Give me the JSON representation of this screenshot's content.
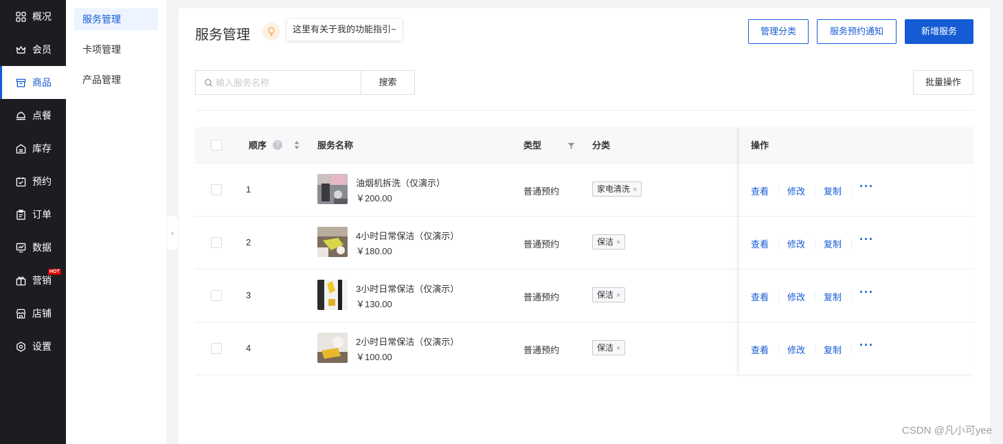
{
  "nav": {
    "items": [
      {
        "label": "概况",
        "icon": "grid-icon"
      },
      {
        "label": "会员",
        "icon": "crown-icon"
      },
      {
        "label": "商品",
        "icon": "store-icon",
        "active": true
      },
      {
        "label": "点餐",
        "icon": "dish-icon"
      },
      {
        "label": "库存",
        "icon": "inventory-icon"
      },
      {
        "label": "预约",
        "icon": "calendar-check-icon"
      },
      {
        "label": "订单",
        "icon": "clipboard-icon"
      },
      {
        "label": "数据",
        "icon": "chart-monitor-icon"
      },
      {
        "label": "营销",
        "icon": "marketing-icon",
        "badge": "HOT"
      },
      {
        "label": "店铺",
        "icon": "shop-icon"
      },
      {
        "label": "设置",
        "icon": "settings-icon"
      }
    ]
  },
  "subnav": {
    "items": [
      {
        "label": "服务管理",
        "active": true
      },
      {
        "label": "卡项管理"
      },
      {
        "label": "产品管理"
      }
    ]
  },
  "header": {
    "title": "服务管理",
    "tip": "这里有关于我的功能指引~",
    "btn_category": "管理分类",
    "btn_notice": "服务预约通知",
    "btn_add": "新增服务"
  },
  "search": {
    "placeholder": "输入服务名称",
    "button": "搜索",
    "batch": "批量操作"
  },
  "table": {
    "columns": {
      "order": "顺序",
      "name": "服务名称",
      "type": "类型",
      "category": "分类",
      "actions": "操作"
    },
    "rows": [
      {
        "order": "1",
        "name": "油烟机拆洗（仅演示）",
        "price": "￥200.00",
        "type": "普通预约",
        "tag": "家电清洗"
      },
      {
        "order": "2",
        "name": "4小时日常保洁（仅演示）",
        "price": "￥180.00",
        "type": "普通预约",
        "tag": "保洁"
      },
      {
        "order": "3",
        "name": "3小时日常保洁（仅演示）",
        "price": "￥130.00",
        "type": "普通预约",
        "tag": "保洁"
      },
      {
        "order": "4",
        "name": "2小时日常保洁（仅演示）",
        "price": "￥100.00",
        "type": "普通预约",
        "tag": "保洁"
      }
    ],
    "actions": {
      "view": "查看",
      "edit": "修改",
      "copy": "复制",
      "more": "···"
    }
  },
  "watermark": "CSDN @凡小可yee",
  "colors": {
    "accent": "#155bd4",
    "nav_bg": "#1c1d21",
    "hot": "#d40000"
  }
}
